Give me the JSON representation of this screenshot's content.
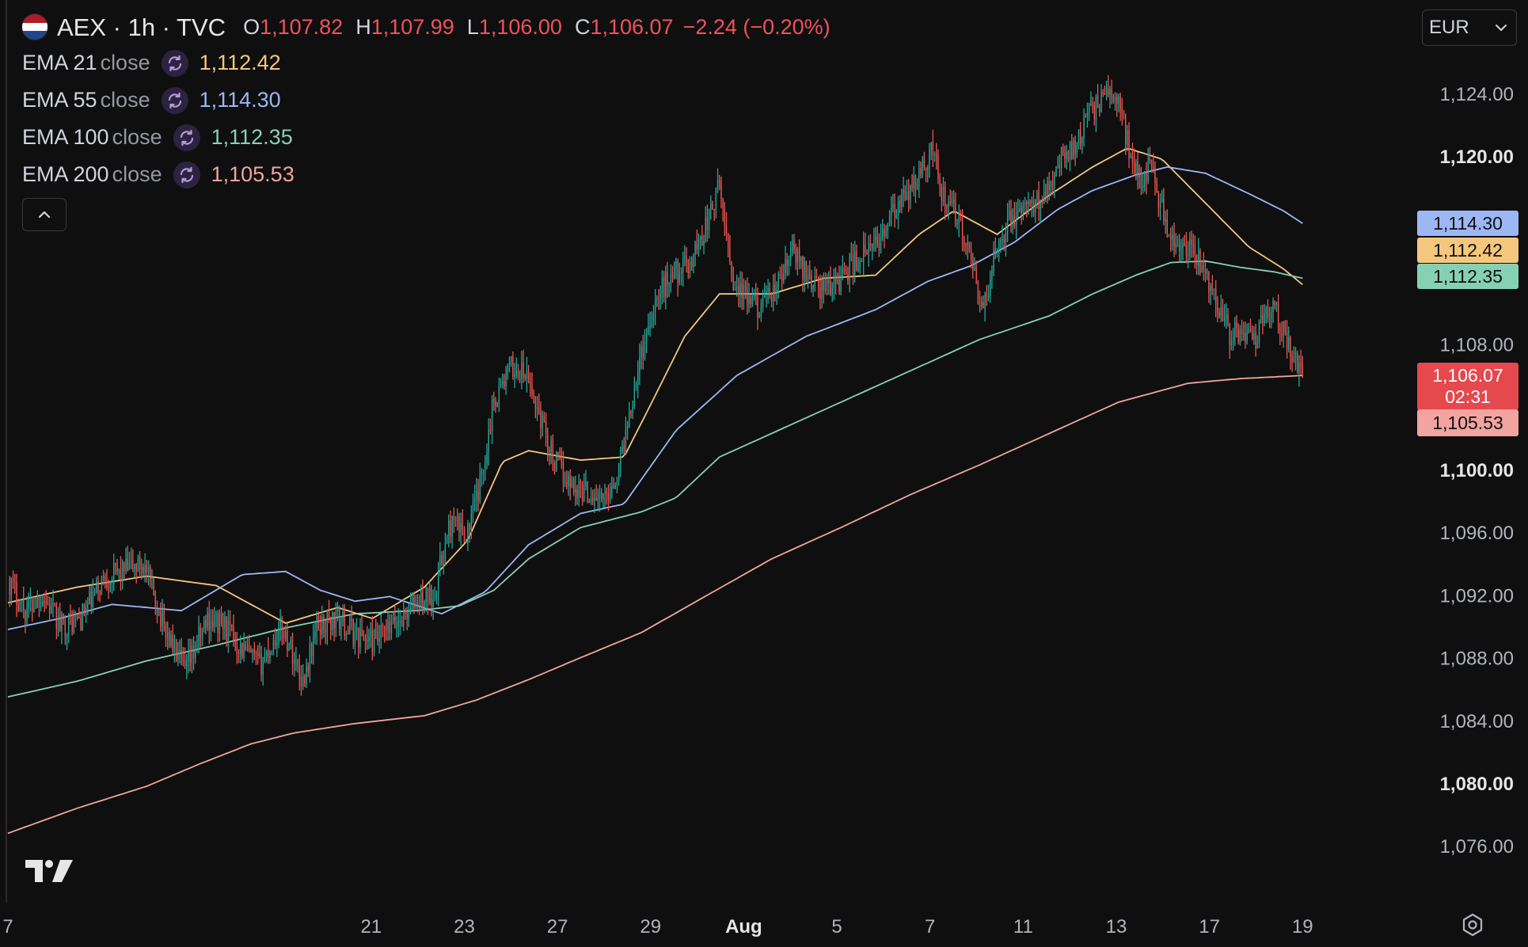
{
  "header": {
    "symbol": "AEX · 1h · TVC",
    "open_label": "O",
    "open": "1,107.82",
    "high_label": "H",
    "high": "1,107.99",
    "low_label": "L",
    "low": "1,106.00",
    "close_label": "C",
    "close": "1,106.07",
    "change": "−2.24 (−0.20%)",
    "flag_colors": [
      "#ae1c28",
      "#ffffff",
      "#21468b"
    ]
  },
  "indicators": [
    {
      "name": "EMA 21",
      "source": "close",
      "value": "1,112.42",
      "color": "#f5c77e"
    },
    {
      "name": "EMA 55",
      "source": "close",
      "value": "1,114.30",
      "color": "#9db7f5"
    },
    {
      "name": "EMA 100",
      "source": "close",
      "value": "1,112.35",
      "color": "#86d1b5"
    },
    {
      "name": "EMA 200",
      "source": "close",
      "value": "1,105.53",
      "color": "#f2a4a0"
    }
  ],
  "currency": {
    "value": "EUR",
    "icon": "chevron-down-icon"
  },
  "price_labels": {
    "ema55": "1,114.30",
    "ema21": "1,112.42",
    "ema100": "1,112.35",
    "last_price": "1,106.07",
    "countdown": "02:31",
    "ema200": "1,105.53"
  },
  "colors": {
    "up": "#26a69a",
    "down": "#ef5350",
    "ema21": "#f5c77e",
    "ema55": "#9db7f5",
    "ema100": "#86d1b5",
    "ema200": "#f2a4a0",
    "last_price_bg": "#e5484d",
    "background": "#0f0f0f"
  },
  "icons": {
    "sync": "sync-icon",
    "collapse": "chevron-up-icon",
    "logo": "tradingview-logo",
    "settings": "settings-icon"
  },
  "chart_data": {
    "type": "candlestick",
    "title": "AEX · 1h · TVC",
    "ylim": [
      1073,
      1127
    ],
    "y_ticks": [
      "1,124.00",
      "1,120.00",
      "1,108.00",
      "1,100.00",
      "1,096.00",
      "1,092.00",
      "1,088.00",
      "1,084.00",
      "1,080.00",
      "1,076.00"
    ],
    "x_ticks": [
      "7",
      "21",
      "23",
      "27",
      "29",
      "Aug",
      "5",
      "7",
      "11",
      "13",
      "17",
      "19"
    ],
    "close_path": [
      [
        0,
        1093.0
      ],
      [
        10,
        1091.0
      ],
      [
        20,
        1092.0
      ],
      [
        30,
        1090.0
      ],
      [
        42,
        1090.5
      ],
      [
        55,
        1093.0
      ],
      [
        65,
        1093.5
      ],
      [
        78,
        1094.0
      ],
      [
        90,
        1090.0
      ],
      [
        102,
        1087.0
      ],
      [
        115,
        1090.5
      ],
      [
        125,
        1090.0
      ],
      [
        135,
        1088.5
      ],
      [
        145,
        1087.5
      ],
      [
        158,
        1090.0
      ],
      [
        170,
        1086.5
      ],
      [
        178,
        1090.0
      ],
      [
        190,
        1090.5
      ],
      [
        200,
        1089.5
      ],
      [
        212,
        1089.0
      ],
      [
        222,
        1090.0
      ],
      [
        235,
        1091.5
      ],
      [
        245,
        1092.0
      ],
      [
        255,
        1096.5
      ],
      [
        265,
        1096.0
      ],
      [
        272,
        1099.0
      ],
      [
        280,
        1104.5
      ],
      [
        290,
        1106.5
      ],
      [
        298,
        1106.0
      ],
      [
        305,
        1104.0
      ],
      [
        315,
        1100.5
      ],
      [
        325,
        1099.0
      ],
      [
        335,
        1098.5
      ],
      [
        343,
        1098.0
      ],
      [
        352,
        1100.0
      ],
      [
        362,
        1106.0
      ],
      [
        372,
        1110.5
      ],
      [
        382,
        1112.5
      ],
      [
        392,
        1113.0
      ],
      [
        402,
        1115.5
      ],
      [
        410,
        1118.0
      ],
      [
        418,
        1112.0
      ],
      [
        428,
        1110.5
      ],
      [
        436,
        1110.5
      ],
      [
        445,
        1112.0
      ],
      [
        452,
        1114.0
      ],
      [
        460,
        1112.5
      ],
      [
        468,
        1111.5
      ],
      [
        478,
        1112.0
      ],
      [
        490,
        1113.5
      ],
      [
        498,
        1114.0
      ],
      [
        506,
        1115.5
      ],
      [
        515,
        1117.0
      ],
      [
        522,
        1118.0
      ],
      [
        532,
        1120.5
      ],
      [
        540,
        1117.0
      ],
      [
        548,
        1116.0
      ],
      [
        556,
        1112.5
      ],
      [
        562,
        1110.0
      ],
      [
        570,
        1114.5
      ],
      [
        578,
        1116.0
      ],
      [
        586,
        1116.5
      ],
      [
        593,
        1117.0
      ],
      [
        600,
        1118.5
      ],
      [
        608,
        1120.0
      ],
      [
        616,
        1121.0
      ],
      [
        625,
        1123.0
      ],
      [
        633,
        1124.0
      ],
      [
        640,
        1123.5
      ],
      [
        646,
        1120.5
      ],
      [
        652,
        1118.5
      ],
      [
        658,
        1119.5
      ],
      [
        664,
        1117.0
      ],
      [
        672,
        1114.0
      ],
      [
        680,
        1114.0
      ],
      [
        688,
        1113.0
      ],
      [
        696,
        1111.0
      ],
      [
        704,
        1108.5
      ],
      [
        712,
        1109.0
      ],
      [
        718,
        1108.0
      ],
      [
        724,
        1110.5
      ],
      [
        731,
        1110.0
      ],
      [
        737,
        1108.0
      ],
      [
        742,
        1107.0
      ],
      [
        746,
        1106.0
      ]
    ],
    "series": [
      {
        "name": "EMA 21",
        "points": [
          [
            0,
            1091.5
          ],
          [
            40,
            1092.5
          ],
          [
            80,
            1093.2
          ],
          [
            120,
            1092.6
          ],
          [
            160,
            1090.2
          ],
          [
            190,
            1091.2
          ],
          [
            210,
            1090.5
          ],
          [
            240,
            1092.5
          ],
          [
            265,
            1095.5
          ],
          [
            285,
            1100.5
          ],
          [
            300,
            1101.2
          ],
          [
            330,
            1100.6
          ],
          [
            355,
            1100.8
          ],
          [
            372,
            1104.5
          ],
          [
            390,
            1108.5
          ],
          [
            410,
            1111.2
          ],
          [
            440,
            1111.2
          ],
          [
            470,
            1112.2
          ],
          [
            500,
            1112.4
          ],
          [
            525,
            1115.0
          ],
          [
            545,
            1116.5
          ],
          [
            570,
            1115.0
          ],
          [
            600,
            1117.5
          ],
          [
            625,
            1119.3
          ],
          [
            645,
            1120.5
          ],
          [
            665,
            1119.8
          ],
          [
            690,
            1117.0
          ],
          [
            715,
            1114.2
          ],
          [
            735,
            1112.8
          ],
          [
            746,
            1111.8
          ]
        ]
      },
      {
        "name": "EMA 55",
        "points": [
          [
            0,
            1089.8
          ],
          [
            30,
            1090.5
          ],
          [
            60,
            1091.4
          ],
          [
            100,
            1091.0
          ],
          [
            135,
            1093.3
          ],
          [
            160,
            1093.5
          ],
          [
            180,
            1092.3
          ],
          [
            200,
            1091.6
          ],
          [
            220,
            1091.9
          ],
          [
            250,
            1090.8
          ],
          [
            275,
            1092.2
          ],
          [
            300,
            1095.2
          ],
          [
            330,
            1097.2
          ],
          [
            355,
            1097.8
          ],
          [
            385,
            1102.5
          ],
          [
            420,
            1106.0
          ],
          [
            460,
            1108.5
          ],
          [
            500,
            1110.2
          ],
          [
            530,
            1112.0
          ],
          [
            555,
            1113.0
          ],
          [
            580,
            1114.5
          ],
          [
            605,
            1116.6
          ],
          [
            625,
            1117.8
          ],
          [
            650,
            1118.8
          ],
          [
            668,
            1119.3
          ],
          [
            690,
            1118.9
          ],
          [
            715,
            1117.6
          ],
          [
            735,
            1116.5
          ],
          [
            746,
            1115.7
          ]
        ]
      },
      {
        "name": "EMA 100",
        "points": [
          [
            0,
            1085.5
          ],
          [
            40,
            1086.5
          ],
          [
            80,
            1087.8
          ],
          [
            120,
            1088.8
          ],
          [
            160,
            1089.9
          ],
          [
            200,
            1090.8
          ],
          [
            235,
            1091.0
          ],
          [
            260,
            1091.3
          ],
          [
            280,
            1092.3
          ],
          [
            300,
            1094.3
          ],
          [
            330,
            1096.3
          ],
          [
            365,
            1097.3
          ],
          [
            385,
            1098.2
          ],
          [
            410,
            1100.8
          ],
          [
            450,
            1102.8
          ],
          [
            490,
            1104.8
          ],
          [
            530,
            1106.8
          ],
          [
            560,
            1108.3
          ],
          [
            600,
            1109.8
          ],
          [
            625,
            1111.2
          ],
          [
            650,
            1112.4
          ],
          [
            670,
            1113.2
          ],
          [
            690,
            1113.3
          ],
          [
            710,
            1112.9
          ],
          [
            730,
            1112.6
          ],
          [
            746,
            1112.2
          ]
        ]
      },
      {
        "name": "EMA 200",
        "points": [
          [
            0,
            1076.8
          ],
          [
            40,
            1078.4
          ],
          [
            80,
            1079.8
          ],
          [
            110,
            1081.2
          ],
          [
            140,
            1082.5
          ],
          [
            165,
            1083.2
          ],
          [
            200,
            1083.8
          ],
          [
            240,
            1084.3
          ],
          [
            270,
            1085.3
          ],
          [
            300,
            1086.6
          ],
          [
            330,
            1088.0
          ],
          [
            365,
            1089.6
          ],
          [
            400,
            1091.8
          ],
          [
            440,
            1094.3
          ],
          [
            480,
            1096.3
          ],
          [
            520,
            1098.4
          ],
          [
            560,
            1100.3
          ],
          [
            600,
            1102.3
          ],
          [
            640,
            1104.3
          ],
          [
            680,
            1105.5
          ],
          [
            710,
            1105.8
          ],
          [
            746,
            1106.0
          ]
        ]
      }
    ]
  }
}
